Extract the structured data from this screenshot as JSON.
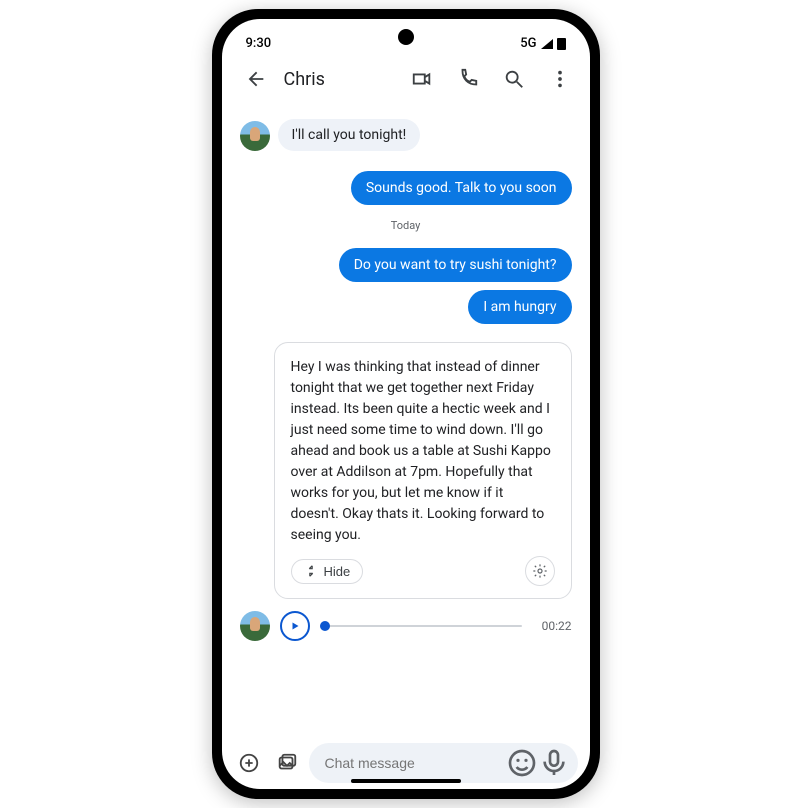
{
  "status": {
    "time": "9:30",
    "network": "5G"
  },
  "header": {
    "contact": "Chris"
  },
  "messages": {
    "incoming1": "I'll call you tonight!",
    "outgoing1": "Sounds good. Talk to you soon",
    "separator": "Today",
    "outgoing2": "Do you want to try sushi tonight?",
    "outgoing3": "I am hungry"
  },
  "transcript": {
    "text": "Hey I was thinking that instead of dinner tonight that we get together next Friday instead. Its been quite a hectic week and I just need some time to wind down.  I'll go ahead and book us a table at Sushi Kappo over at Addilson at 7pm.  Hopefully that works for you, but let me know if it doesn't. Okay thats it. Looking forward to seeing you.",
    "hide_label": "Hide"
  },
  "voice": {
    "duration": "00:22"
  },
  "composer": {
    "placeholder": "Chat message"
  }
}
